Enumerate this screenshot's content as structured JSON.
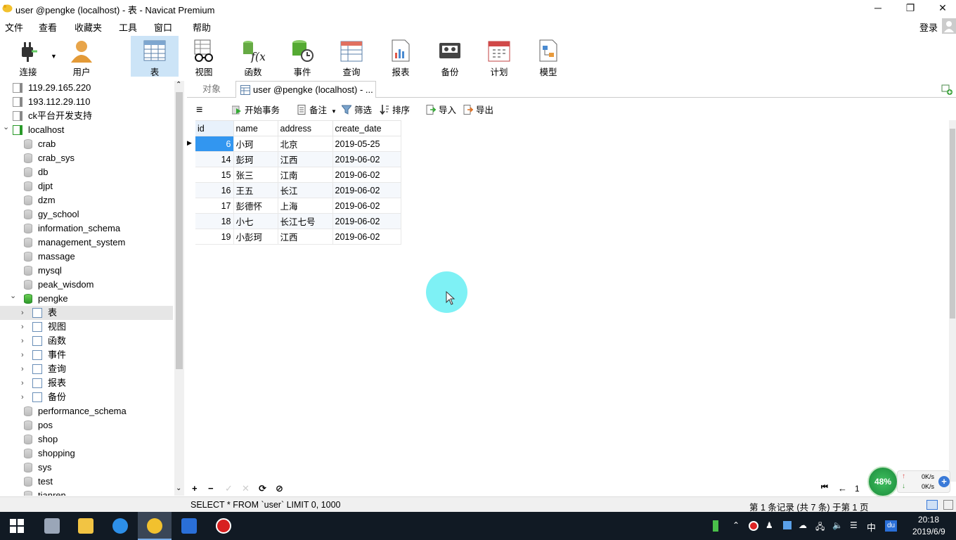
{
  "window": {
    "title": "user @pengke (localhost) - 表 - Navicat Premium",
    "minimize": "─",
    "restore": "❐",
    "close": "✕"
  },
  "menu": [
    "文件",
    "查看",
    "收藏夹",
    "工具",
    "窗口",
    "帮助"
  ],
  "login": "登录",
  "toolbar": [
    {
      "label": "连接",
      "icon": "plug-icon"
    },
    {
      "label": "用户",
      "icon": "user-icon"
    },
    {
      "label": "表",
      "icon": "table-icon",
      "active": true
    },
    {
      "label": "视图",
      "icon": "view-glasses-icon"
    },
    {
      "label": "函数",
      "icon": "function-icon"
    },
    {
      "label": "事件",
      "icon": "event-clock-icon"
    },
    {
      "label": "查询",
      "icon": "query-icon"
    },
    {
      "label": "报表",
      "icon": "report-icon"
    },
    {
      "label": "备份",
      "icon": "backup-icon"
    },
    {
      "label": "计划",
      "icon": "calendar-icon"
    },
    {
      "label": "模型",
      "icon": "model-icon"
    }
  ],
  "tree": [
    {
      "label": "119.29.165.220",
      "type": "server"
    },
    {
      "label": "193.112.29.110",
      "type": "server"
    },
    {
      "label": "ck平台开发支持",
      "type": "server"
    },
    {
      "label": "localhost",
      "type": "server-open"
    },
    {
      "label": "crab",
      "type": "db"
    },
    {
      "label": "crab_sys",
      "type": "db"
    },
    {
      "label": "db",
      "type": "db"
    },
    {
      "label": "djpt",
      "type": "db"
    },
    {
      "label": "dzm",
      "type": "db"
    },
    {
      "label": "gy_school",
      "type": "db"
    },
    {
      "label": "information_schema",
      "type": "db"
    },
    {
      "label": "management_system",
      "type": "db"
    },
    {
      "label": "massage",
      "type": "db"
    },
    {
      "label": "mysql",
      "type": "db"
    },
    {
      "label": "peak_wisdom",
      "type": "db"
    },
    {
      "label": "pengke",
      "type": "db-open"
    },
    {
      "label": "表",
      "type": "node",
      "selected": true
    },
    {
      "label": "视图",
      "type": "node"
    },
    {
      "label": "函数",
      "type": "node"
    },
    {
      "label": "事件",
      "type": "node"
    },
    {
      "label": "查询",
      "type": "node"
    },
    {
      "label": "报表",
      "type": "node"
    },
    {
      "label": "备份",
      "type": "node"
    },
    {
      "label": "performance_schema",
      "type": "db"
    },
    {
      "label": "pos",
      "type": "db"
    },
    {
      "label": "shop",
      "type": "db"
    },
    {
      "label": "shopping",
      "type": "db"
    },
    {
      "label": "sys",
      "type": "db"
    },
    {
      "label": "test",
      "type": "db"
    },
    {
      "label": "tianren",
      "type": "db"
    }
  ],
  "tabs": {
    "objects": "对象",
    "active": "user @pengke (localhost) - ..."
  },
  "subtoolbar": {
    "begin": "开始事务",
    "memo": "备注",
    "filter": "筛选",
    "sort": "排序",
    "import": "导入",
    "export": "导出"
  },
  "grid": {
    "columns": [
      "id",
      "name",
      "address",
      "create_date"
    ],
    "rows": [
      [
        "6",
        "小珂",
        "北京",
        "2019-05-25"
      ],
      [
        "14",
        "彭珂",
        "江西",
        "2019-06-02"
      ],
      [
        "15",
        "张三",
        "江南",
        "2019-06-02"
      ],
      [
        "16",
        "王五",
        "长江",
        "2019-06-02"
      ],
      [
        "17",
        "彭德怀",
        "上海",
        "2019-06-02"
      ],
      [
        "18",
        "小七",
        "长江七号",
        "2019-06-02"
      ],
      [
        "19",
        "小彭珂",
        "江西",
        "2019-06-02"
      ]
    ]
  },
  "nav": {
    "add": "+",
    "remove": "−",
    "apply": "✓",
    "cancel": "✕",
    "refresh": "⟳",
    "stop": "⊘",
    "page": "1"
  },
  "status": {
    "sql": "SELECT * FROM `user` LIMIT 0, 1000",
    "records": "第 1 条记录 (共 7 条) 于第 1 页"
  },
  "netwidget": {
    "percent": "48%",
    "up": "0K/s",
    "down": "0K/s"
  },
  "taskbar": {
    "time": "20:18",
    "date": "2019/6/9",
    "ime": "中"
  },
  "colors": {
    "selection": "#3296f0",
    "toolbar_active": "#cce4f7",
    "taskbar": "#111a24",
    "cursor_highlight": "#7ef1f5"
  }
}
